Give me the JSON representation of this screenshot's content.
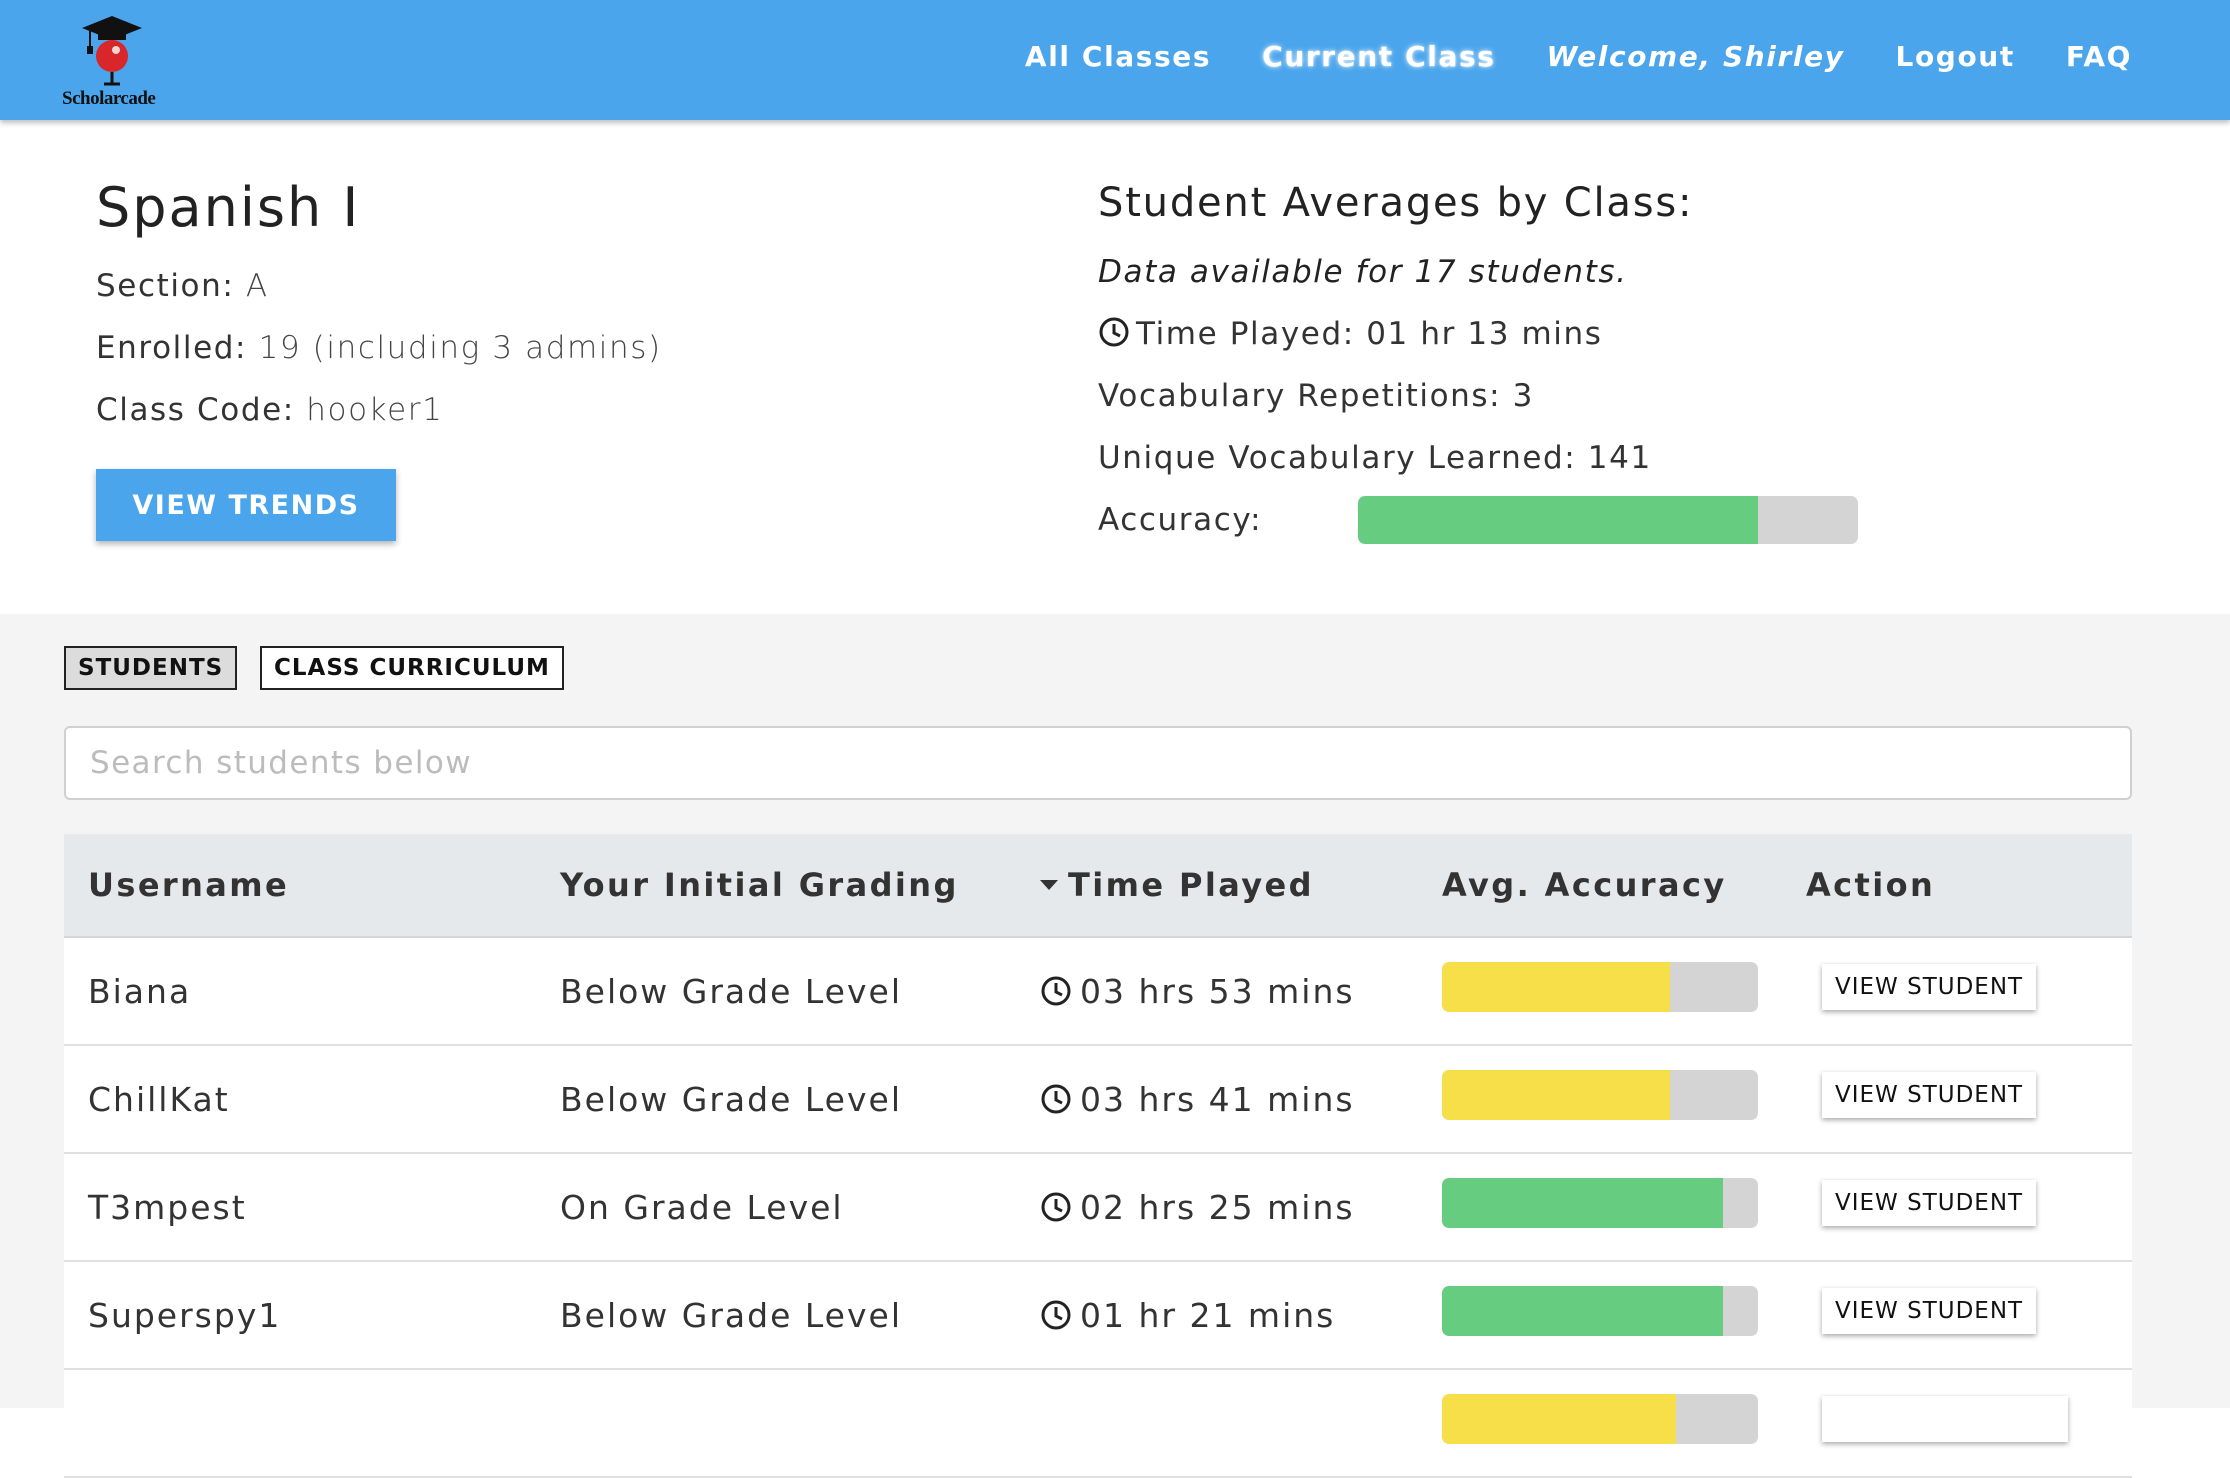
{
  "app": {
    "logo_text": "Scholarcade"
  },
  "nav": {
    "items": [
      {
        "label": "All Classes"
      },
      {
        "label": "Current Class"
      },
      {
        "label": "Welcome, Shirley"
      },
      {
        "label": "Logout"
      },
      {
        "label": "FAQ"
      }
    ]
  },
  "class_info": {
    "title": "Spanish I",
    "section_label": "Section:",
    "section_value": "A",
    "enrolled_label": "Enrolled:",
    "enrolled_value": "19 (including 3 admins)",
    "code_label": "Class Code:",
    "code_value": "hooker1",
    "trends_button": "VIEW TRENDS"
  },
  "averages": {
    "title": "Student Averages by Class:",
    "note": "Data available for 17 students.",
    "time_label": "Time Played:",
    "time_value": "01 hr 13 mins",
    "reps_label": "Vocabulary Repetitions:",
    "reps_value": "3",
    "unique_label": "Unique Vocabulary Learned:",
    "unique_value": "141",
    "accuracy_label": "Accuracy:",
    "accuracy_fraction": 0.8,
    "accuracy_color": "#66cc7f"
  },
  "tabs": [
    {
      "label": "STUDENTS",
      "active": true
    },
    {
      "label": "CLASS CURRICULUM",
      "active": false
    }
  ],
  "search": {
    "placeholder": "Search students below",
    "value": ""
  },
  "table": {
    "headers": {
      "username": "Username",
      "grading": "Your Initial Grading",
      "time": "Time Played",
      "accuracy": "Avg. Accuracy",
      "action": "Action"
    },
    "sort_column": "time",
    "action_label": "VIEW STUDENT",
    "rows": [
      {
        "username": "Biana",
        "grading": "Below Grade Level",
        "time": "03 hrs 53 mins",
        "accuracy_fraction": 0.72,
        "accuracy_color": "#f7df4a"
      },
      {
        "username": "ChillKat",
        "grading": "Below Grade Level",
        "time": "03 hrs 41 mins",
        "accuracy_fraction": 0.72,
        "accuracy_color": "#f7df4a"
      },
      {
        "username": "T3mpest",
        "grading": "On Grade Level",
        "time": "02 hrs 25 mins",
        "accuracy_fraction": 0.89,
        "accuracy_color": "#66cc7f"
      },
      {
        "username": "Superspy1",
        "grading": "Below Grade Level",
        "time": "01 hr 21 mins",
        "accuracy_fraction": 0.89,
        "accuracy_color": "#66cc7f"
      }
    ]
  }
}
